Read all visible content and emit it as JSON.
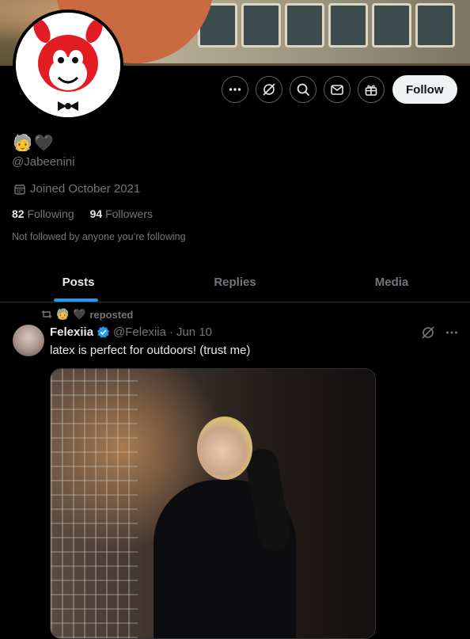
{
  "profile": {
    "display_emojis": [
      "🧓",
      "🖤"
    ],
    "handle": "@Jabeenini",
    "joined": "Joined October 2021",
    "following_count": "82",
    "following_label": "Following",
    "followers_count": "94",
    "followers_label": "Followers",
    "not_followed_text": "Not followed by anyone you’re following"
  },
  "actions": {
    "more_icon": "more-icon",
    "grok_icon": "grok-icon",
    "search_icon": "search-icon",
    "message_icon": "message-icon",
    "subscribe_icon": "gift-icon",
    "follow_label": "Follow"
  },
  "tabs": [
    {
      "label": "Posts",
      "active": true
    },
    {
      "label": "Replies",
      "active": false
    },
    {
      "label": "Media",
      "active": false
    }
  ],
  "post": {
    "repost_label": "reposted",
    "repost_emojis": [
      "🧓",
      "🖤"
    ],
    "author_name": "Felexiia",
    "verified": true,
    "author_handle": "@Felexiia",
    "separator": "·",
    "date": "Jun 10",
    "text": "latex is perfect for outdoors! (trust me)"
  },
  "colors": {
    "background": "#000000",
    "text_primary": "#e7e9ea",
    "text_secondary": "#71767b",
    "accent": "#1d9bf0",
    "border": "#2f3336"
  }
}
